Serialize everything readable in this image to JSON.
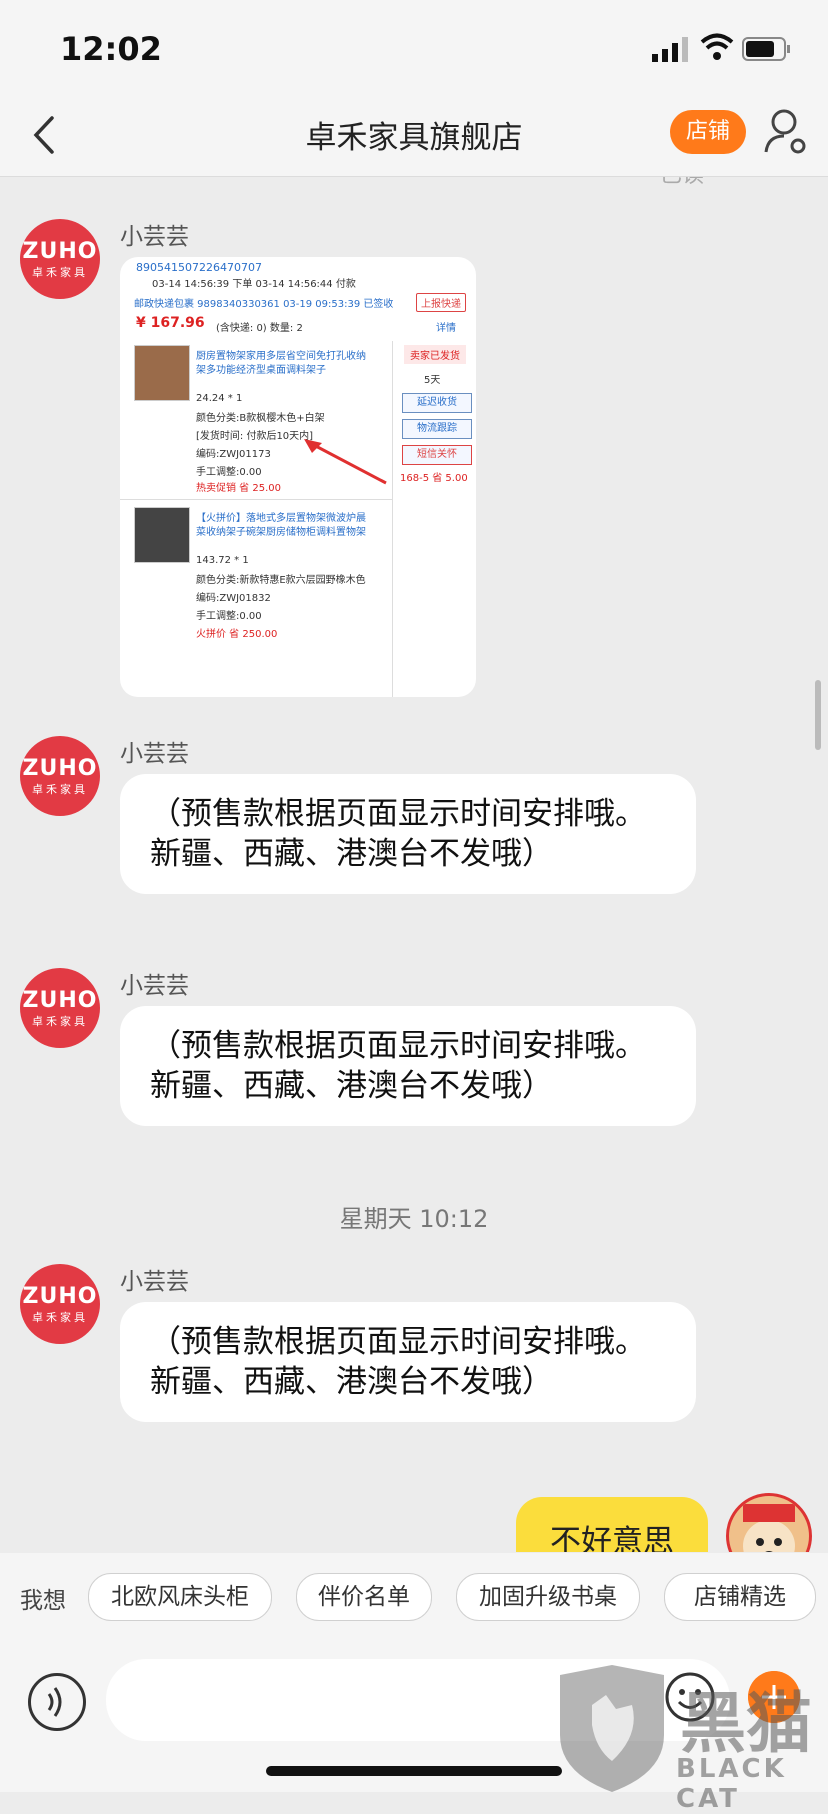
{
  "status": {
    "time": "12:02"
  },
  "header": {
    "title": "卓禾家具旗舰店",
    "shop_button": "店铺"
  },
  "chat": {
    "cut_timestamp": "已读",
    "avatar_brand": "ZUHO",
    "avatar_sub": "卓禾家具",
    "sender": "小芸芸",
    "order_card": {
      "order_no": "890541507226470707",
      "times": "03-14 14:56:39 下单   03-14 14:56:44 付款",
      "shipping": "邮政快递包裹 9898340330361 03-19 09:53:39 已签收",
      "report_btn": "上报快递",
      "price": "¥ 167.96",
      "price_note": "(含快递: 0)  数量: 2",
      "detail": "详情",
      "seller_status": "卖家已发货",
      "days": "5天",
      "btn_delay": "延迟收货",
      "btn_track": "物流跟踪",
      "btn_sms": "短信关怀",
      "item1_title1": "厨房置物架家用多层省空间免打孔收纳",
      "item1_title2": "架多功能经济型桌面调料架子",
      "item1_price": "24.24 * 1",
      "item1_sku": "颜色分类:B款枫樱木色+白架",
      "item1_ship": "[发货时间: 付款后10天内]",
      "item1_code": "编码:ZWJ01173",
      "item1_adj": "手工调整:0.00",
      "item1_promo": "热卖促销 省 25.00",
      "side_promo": "168-5 省 5.00",
      "item2_title1": "【火拼价】落地式多层置物架微波炉晨",
      "item2_title2": "菜收纳架子碗架厨房储物柜调料置物架",
      "item2_price": "143.72 * 1",
      "item2_sku": "颜色分类:新款特惠E款六层园野橡木色",
      "item2_code": "编码:ZWJ01832",
      "item2_adj": "手工调整:0.00",
      "item2_promo": "火拼价 省 250.00"
    },
    "message_text": "（预售款根据页面显示时间安排哦。新疆、西藏、港澳台不发哦）",
    "day_timestamp": "星期天 10:12",
    "my_message": "不好意思"
  },
  "quick": {
    "label": "我想",
    "chips": [
      "北欧风床头柜",
      "伴价名单",
      "加固升级书桌",
      "店铺精选"
    ]
  },
  "watermark": {
    "line1": "黑猫",
    "line2": "BLACK CAT"
  },
  "colors": {
    "accent": "#ff7a1a",
    "brand": "#e23a44",
    "my_bubble": "#fbdd3c"
  }
}
